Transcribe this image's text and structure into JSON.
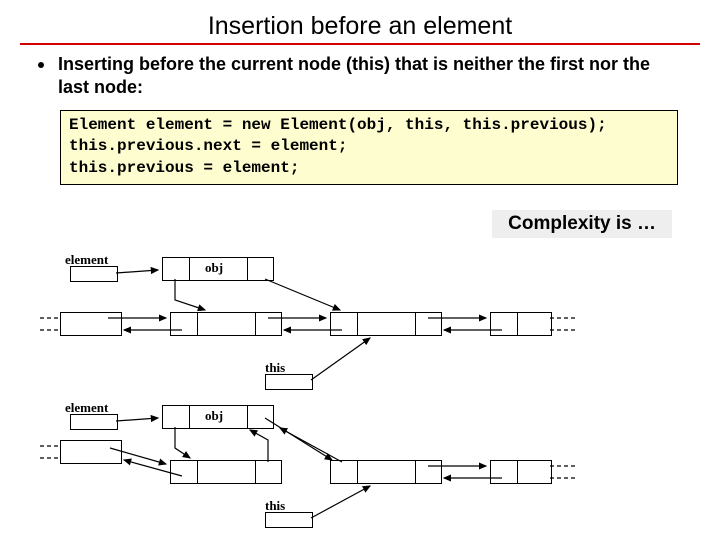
{
  "title": "Insertion before an element",
  "bullet_text": "Inserting before the current node (this) that is neither the first nor the last node:",
  "code": {
    "l1": "Element element = new Element(obj, this, this.previous);",
    "l2": "this.previous.next = element;",
    "l3": "this.previous = element;"
  },
  "complexity_label": "Complexity is …",
  "labels": {
    "element": "element",
    "obj": "obj",
    "this": "this"
  }
}
